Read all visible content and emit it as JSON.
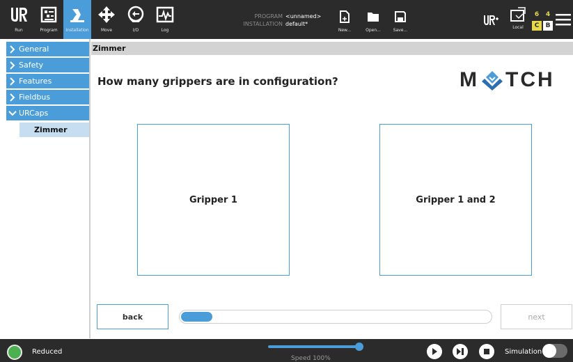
{
  "header": {
    "tabs": [
      {
        "label": "Run",
        "icon": "ur-logo-icon"
      },
      {
        "label": "Program",
        "icon": "program-icon"
      },
      {
        "label": "Installation",
        "icon": "installation-icon",
        "active": true
      },
      {
        "label": "Move",
        "icon": "move-icon"
      },
      {
        "label": "I/O",
        "icon": "io-icon"
      },
      {
        "label": "Log",
        "icon": "log-icon"
      }
    ],
    "program_key": "PROGRAM",
    "program_value": "<unnamed>",
    "installation_key": "INSTALLATION",
    "installation_value": "default*",
    "file_buttons": [
      {
        "label": "New...",
        "icon": "new-file-icon"
      },
      {
        "label": "Open...",
        "icon": "open-folder-icon"
      },
      {
        "label": "Save...",
        "icon": "save-icon"
      }
    ],
    "local_label": "Local",
    "mode_grid": [
      "6",
      "4",
      "C",
      "B"
    ],
    "accent_color": "#4a9dd8"
  },
  "sidebar": {
    "items": [
      {
        "label": "General",
        "expanded": false
      },
      {
        "label": "Safety",
        "expanded": false
      },
      {
        "label": "Features",
        "expanded": false
      },
      {
        "label": "Fieldbus",
        "expanded": false
      },
      {
        "label": "URCaps",
        "expanded": true
      }
    ],
    "sub_item": "Zimmer"
  },
  "main": {
    "breadcrumb": "Zimmer",
    "question": "How many grippers are in configuration?",
    "logo_left": "M",
    "logo_right": "TCH",
    "choices": [
      "Gripper 1",
      "Gripper 1 and 2"
    ],
    "back_label": "back",
    "next_label": "next",
    "progress": 0.1
  },
  "footer": {
    "status_label": "Reduced",
    "status_color": "#4caf50",
    "speed_label": "Speed 100%",
    "speed": 1.0,
    "simulation_label": "Simulation",
    "simulation_on": false
  }
}
